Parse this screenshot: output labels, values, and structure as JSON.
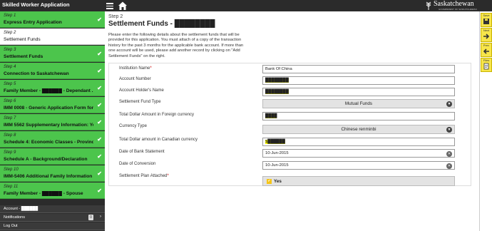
{
  "app": {
    "title": "Skilled Worker Application"
  },
  "logo": {
    "word": "Saskatchewan",
    "sub": "GOVERNMENT OF SASKATCHEWAN"
  },
  "sidebar": {
    "steps": [
      {
        "num": "Step 1",
        "title": "Express Entry Application",
        "done": true
      },
      {
        "num": "Step 2",
        "title": "Settlement Funds",
        "done": false
      },
      {
        "num": "Step 3",
        "title": "Settlement Funds",
        "done": true
      },
      {
        "num": "Step 4",
        "title": "Connection to Saskatchewan",
        "done": true
      },
      {
        "num": "Step 5",
        "title": "Family Member - ██████ - Dependant ...",
        "done": true
      },
      {
        "num": "Step 6",
        "title": "IMM 0008 - Generic Application Form for Ca...",
        "done": true
      },
      {
        "num": "Step 7",
        "title": "IMM 5562 Supplementary Information: Your...",
        "done": true
      },
      {
        "num": "Step 8",
        "title": "Schedule 4: Economic Classes - Provincial...",
        "done": true
      },
      {
        "num": "Step 9",
        "title": "Schedule A - Background/Declaration",
        "done": true
      },
      {
        "num": "Step 10",
        "title": "IMM-5406 Additional Family Information",
        "done": true
      },
      {
        "num": "Step 11",
        "title": "Family Member - ██████ - Spouse",
        "done": true
      }
    ],
    "account_label": "Account - ██████",
    "notifications_label": "Notifications",
    "notifications_count": "0",
    "logout_label": "Log Out"
  },
  "main": {
    "step_label": "Step 2",
    "title": "Settlement Funds - ████████",
    "intro": "Please enter the following details about the settlement funds that will be provided for this application. You must attach of a copy of the transaction history for the past 3 months for the applicable bank account. If more than one account will be used, please add another record by clicking on \"Add Settlement Funds\" on the right."
  },
  "form": {
    "institution_label": "Institution Name",
    "institution_value": "Bank Of China",
    "account_number_label": "Account Number",
    "account_number_value": "████████",
    "holder_label": "Account Holder's Name",
    "holder_value": "████████",
    "fund_type_label": "Settlement Fund Type",
    "fund_type_value": "Mutual Funds",
    "foreign_amount_label": "Total Dollar Amount in Foreign currency",
    "foreign_amount_value": "████",
    "currency_type_label": "Currency Type",
    "currency_type_value": "Chinese renminbi",
    "cad_amount_label": "Total Dollar amount in Canadian currency",
    "cad_amount_value": "$██████",
    "statement_date_label": "Date of Bank Statement",
    "statement_date_value": "10-Jun-2015",
    "conversion_date_label": "Date of Conversion",
    "conversion_date_value": "10-Jun-2015",
    "plan_attached_label": "Settlement Plan Attached",
    "plan_attached_value": "Yes",
    "required_mark": "*"
  },
  "toolbar": {
    "save": "Save",
    "next": "Next",
    "prev": "Prev",
    "files": "Files"
  },
  "colors": {
    "sidebar_done": "#4cc54c",
    "topbar": "#2b2b2b",
    "toolbar_button": "#f7e54a",
    "highlight": "#f5f500"
  }
}
